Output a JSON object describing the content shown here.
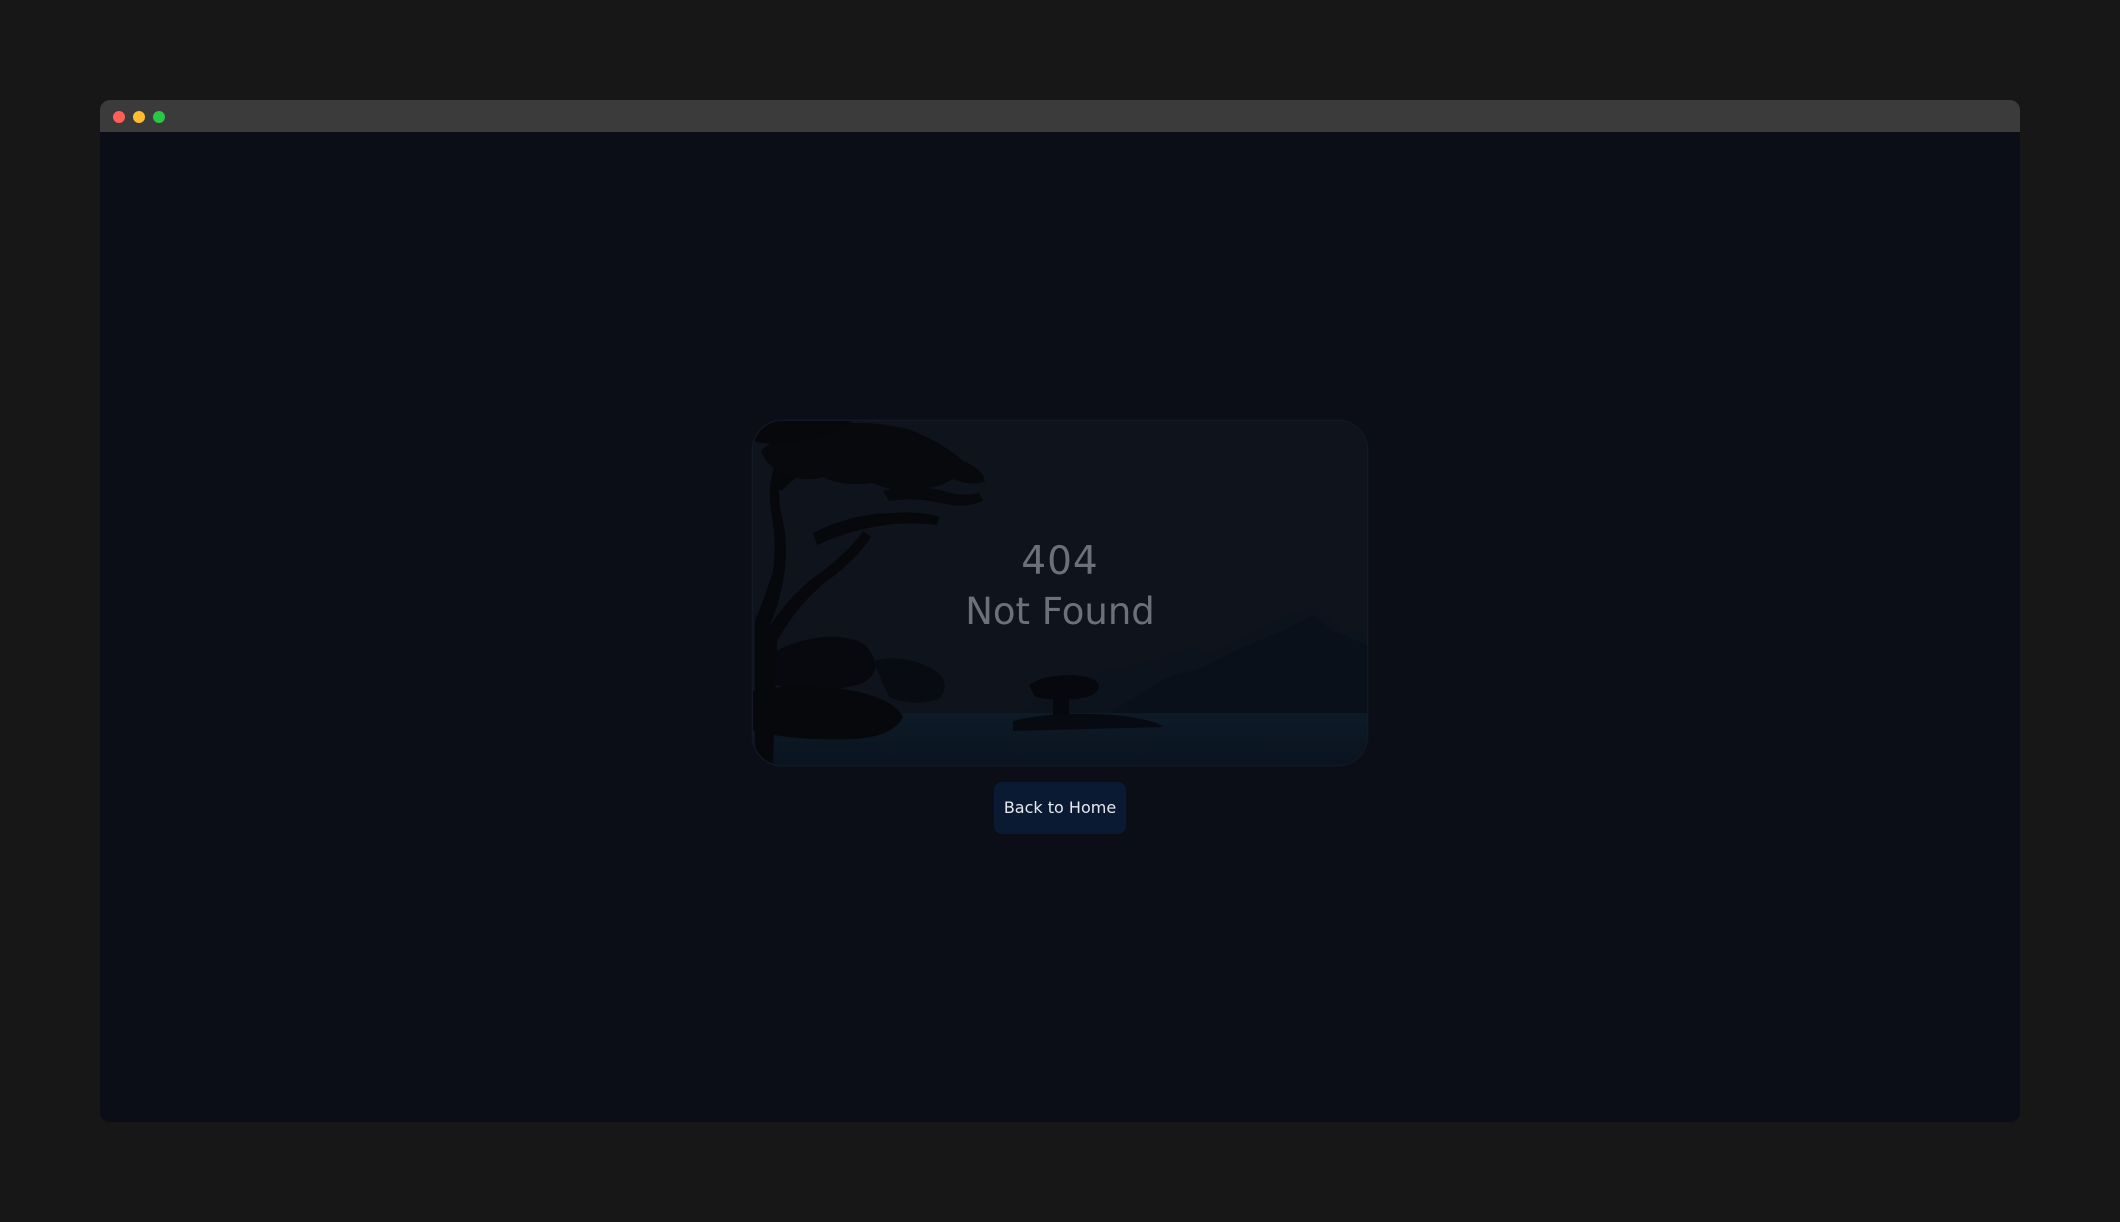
{
  "window": {
    "traffic_lights": {
      "close_color": "#ff5f57",
      "minimize_color": "#febc2e",
      "maximize_color": "#28c840"
    }
  },
  "error_card": {
    "code": "404",
    "message": "Not Found",
    "illustration": "tree-and-mountains-silhouette"
  },
  "actions": {
    "back_label": "Back to Home"
  },
  "colors": {
    "background": "#0b0e17",
    "button": "#0b1a33",
    "text_muted": "#6d7079"
  }
}
